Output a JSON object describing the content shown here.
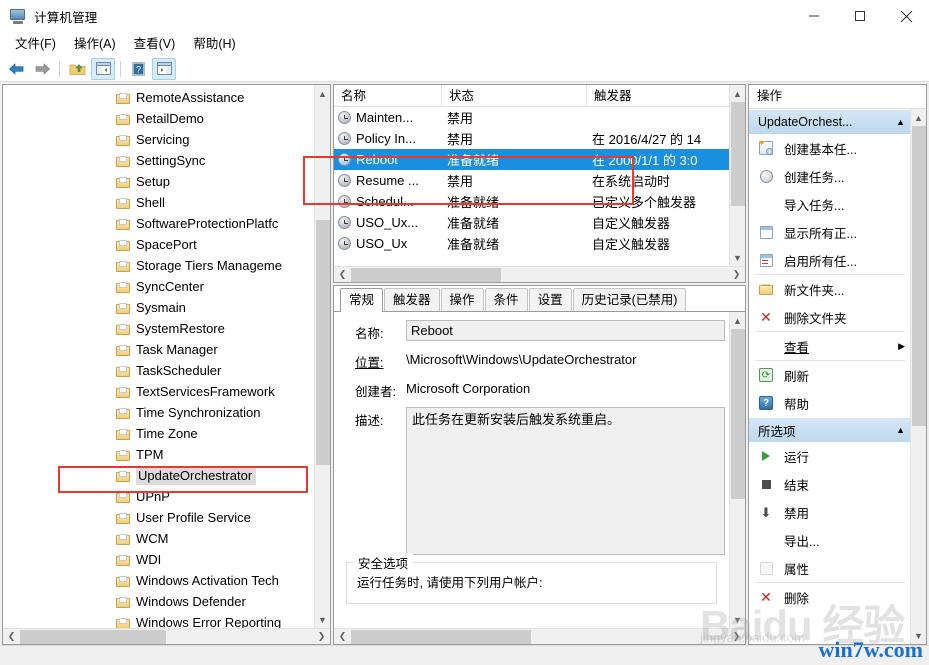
{
  "window": {
    "title": "计算机管理",
    "icon": "computer-management-icon",
    "controls": {
      "minimize": "−",
      "maximize": "□",
      "close": "✕"
    }
  },
  "menubar": {
    "items": [
      {
        "label": "文件(F)",
        "name": "menu-file"
      },
      {
        "label": "操作(A)",
        "name": "menu-action"
      },
      {
        "label": "查看(V)",
        "name": "menu-view"
      },
      {
        "label": "帮助(H)",
        "name": "menu-help"
      }
    ]
  },
  "toolbar": {
    "buttons": [
      {
        "icon": "back-arrow-icon",
        "label": ""
      },
      {
        "icon": "forward-arrow-icon",
        "label": ""
      },
      {
        "icon": "up-folder-icon",
        "label": ""
      },
      {
        "icon": "show-console-tree-icon",
        "label": ""
      },
      {
        "icon": "help-icon",
        "label": ""
      },
      {
        "icon": "show-action-pane-icon",
        "label": ""
      }
    ]
  },
  "tree": {
    "items": [
      {
        "label": "RemoteAssistance",
        "selected": false
      },
      {
        "label": "RetailDemo",
        "selected": false
      },
      {
        "label": "Servicing",
        "selected": false
      },
      {
        "label": "SettingSync",
        "selected": false
      },
      {
        "label": "Setup",
        "selected": false
      },
      {
        "label": "Shell",
        "selected": false
      },
      {
        "label": "SoftwareProtectionPlatfc",
        "selected": false
      },
      {
        "label": "SpacePort",
        "selected": false
      },
      {
        "label": "Storage Tiers Manageme",
        "selected": false
      },
      {
        "label": "SyncCenter",
        "selected": false
      },
      {
        "label": "Sysmain",
        "selected": false
      },
      {
        "label": "SystemRestore",
        "selected": false
      },
      {
        "label": "Task Manager",
        "selected": false
      },
      {
        "label": "TaskScheduler",
        "selected": false
      },
      {
        "label": "TextServicesFramework",
        "selected": false
      },
      {
        "label": "Time Synchronization",
        "selected": false
      },
      {
        "label": "Time Zone",
        "selected": false
      },
      {
        "label": "TPM",
        "selected": false
      },
      {
        "label": "UpdateOrchestrator",
        "selected": true
      },
      {
        "label": "UPnP",
        "selected": false
      },
      {
        "label": "User Profile Service",
        "selected": false
      },
      {
        "label": "WCM",
        "selected": false
      },
      {
        "label": "WDI",
        "selected": false
      },
      {
        "label": "Windows Activation Tech",
        "selected": false
      },
      {
        "label": "Windows Defender",
        "selected": false
      },
      {
        "label": "Windows Error Reporting",
        "selected": false
      }
    ]
  },
  "tasklist": {
    "columns": [
      {
        "label": "名称",
        "name": "column-name"
      },
      {
        "label": "状态",
        "name": "column-status"
      },
      {
        "label": "触发器",
        "name": "column-trigger"
      }
    ],
    "rows": [
      {
        "name": "Mainten...",
        "status": "禁用",
        "trigger": "",
        "selected": false
      },
      {
        "name": "Policy In...",
        "status": "禁用",
        "trigger": "在 2016/4/27 的 14",
        "selected": false
      },
      {
        "name": "Reboot",
        "status": "准备就绪",
        "trigger": "在 2000/1/1 的 3:0",
        "selected": true
      },
      {
        "name": "Resume ...",
        "status": "禁用",
        "trigger": "在系统启动时",
        "selected": false
      },
      {
        "name": "Schedul...",
        "status": "准备就绪",
        "trigger": "已定义多个触发器",
        "selected": false
      },
      {
        "name": "USO_Ux...",
        "status": "准备就绪",
        "trigger": "自定义触发器",
        "selected": false
      },
      {
        "name": "USO_Ux",
        "status": "准备就绪",
        "trigger": "自定义触发器",
        "selected": false
      }
    ]
  },
  "detail": {
    "tabs": [
      {
        "label": "常规",
        "active": true
      },
      {
        "label": "触发器",
        "active": false
      },
      {
        "label": "操作",
        "active": false
      },
      {
        "label": "条件",
        "active": false
      },
      {
        "label": "设置",
        "active": false
      },
      {
        "label": "历史记录(已禁用)",
        "active": false
      }
    ],
    "fields": {
      "name_label": "名称:",
      "name_value": "Reboot",
      "location_label": "位置:",
      "location_value": "\\Microsoft\\Windows\\UpdateOrchestrator",
      "author_label": "创建者:",
      "author_value": "Microsoft Corporation",
      "description_label": "描述:",
      "description_value": "此任务在更新安装后触发系统重启。"
    },
    "security_group": {
      "title": "安全选项",
      "text": "运行任务时, 请使用下列用户帐户:"
    }
  },
  "actions": {
    "title": "操作",
    "sections": [
      {
        "header": "UpdateOrchest...",
        "name": "actions-section-updateorchestrator",
        "items": [
          {
            "label": "创建基本任...",
            "icon": "create-basic-task-icon",
            "underline": false
          },
          {
            "label": "创建任务...",
            "icon": "create-task-icon",
            "underline": false
          },
          {
            "label": "导入任务...",
            "icon": "none",
            "underline": false
          },
          {
            "label": "显示所有正...",
            "icon": "display-running-tasks-icon",
            "underline": false
          },
          {
            "label": "启用所有任...",
            "icon": "enable-all-tasks-icon",
            "underline": false
          },
          {
            "label": "新文件夹...",
            "icon": "new-folder-icon",
            "underline": false
          },
          {
            "label": "删除文件夹",
            "icon": "delete-folder-icon",
            "underline": false
          },
          {
            "label": "查看",
            "icon": "none",
            "underline": true,
            "submenu": true
          },
          {
            "label": "刷新",
            "icon": "refresh-icon",
            "underline": false
          },
          {
            "label": "帮助",
            "icon": "help-icon",
            "underline": false
          }
        ]
      },
      {
        "header": "所选项",
        "name": "actions-section-selected-item",
        "items": [
          {
            "label": "运行",
            "icon": "run-icon",
            "underline": false
          },
          {
            "label": "结束",
            "icon": "end-icon",
            "underline": false
          },
          {
            "label": "禁用",
            "icon": "disable-icon",
            "underline": false
          },
          {
            "label": "导出...",
            "icon": "none",
            "underline": false
          },
          {
            "label": "属性",
            "icon": "properties-icon",
            "underline": false
          },
          {
            "label": "删除",
            "icon": "delete-icon",
            "underline": false
          }
        ]
      }
    ]
  },
  "watermarks": {
    "baidu": "Baidu 经验",
    "baidu_sub": "jingyan.baidu.com",
    "site": "win7w.com"
  },
  "colors": {
    "selection_blue": "#1a8fe0",
    "annotation_red": "#e8392f",
    "section_header": "#bcd8ef",
    "tree_selection": "#dcdcdc"
  }
}
